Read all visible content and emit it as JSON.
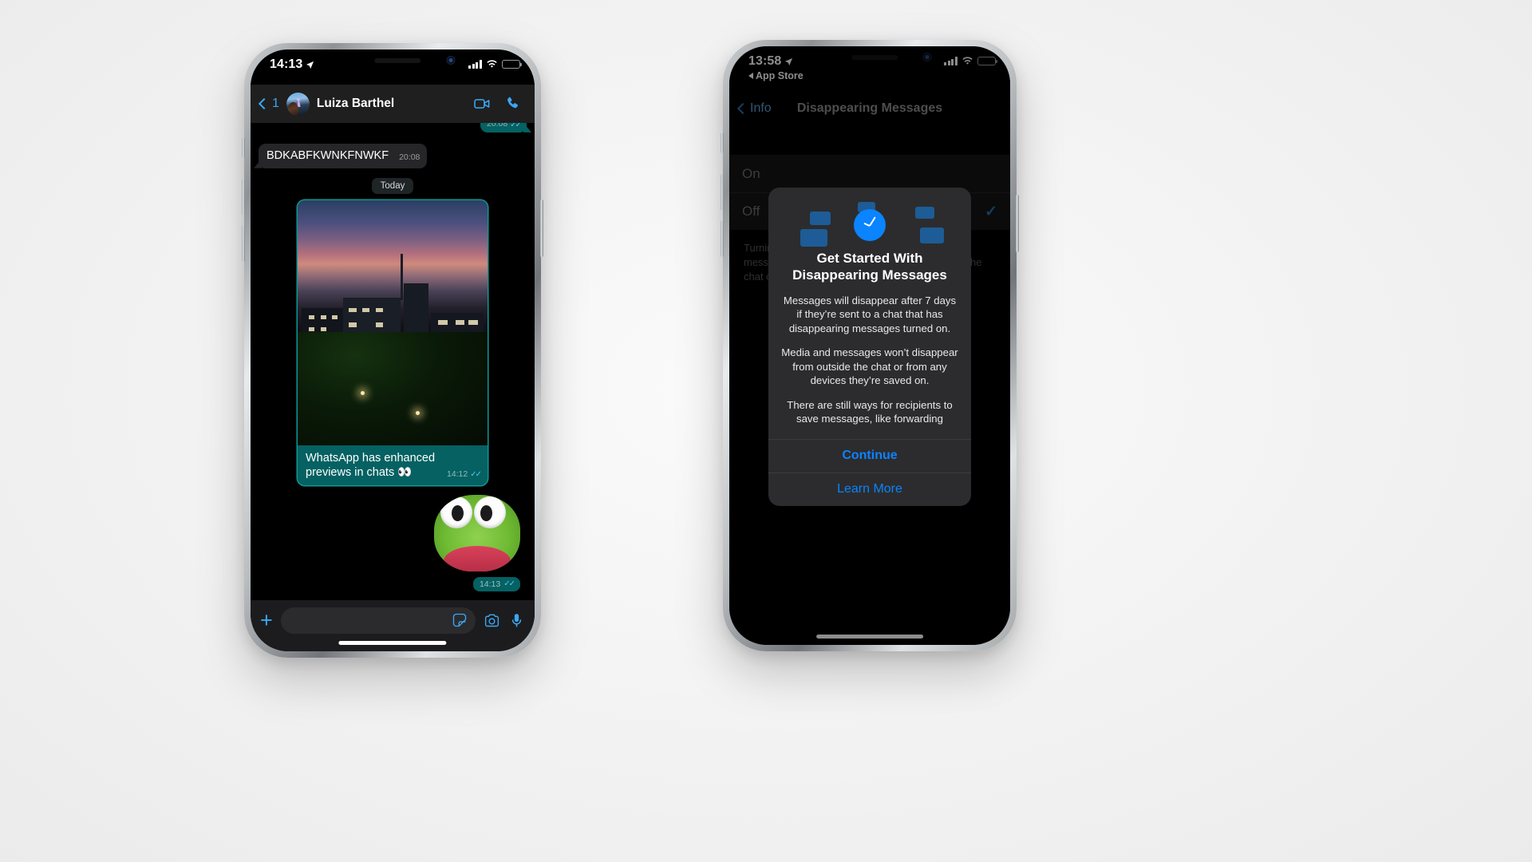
{
  "phone1": {
    "status": {
      "time": "14:13",
      "location_icon": "location-arrow-icon",
      "battery_icon": "battery-icon",
      "wifi_icon": "wifi-icon",
      "signal_icon": "cellular-bars-icon"
    },
    "header": {
      "back_icon": "chevron-left-icon",
      "unread_count": "1",
      "avatar": "contact-avatar",
      "contact_name": "Luiza Barthel",
      "video_call_icon": "video-camera-icon",
      "voice_call_icon": "phone-icon"
    },
    "messages": [
      {
        "type": "outgoing-partial",
        "text": "",
        "time": "20:08",
        "status_icon": "double-check-icon"
      },
      {
        "type": "incoming",
        "text": "BDKABFKWNKFNWKF",
        "time": "20:08"
      }
    ],
    "day_separator": "Today",
    "media_message": {
      "forward_icon": "forward-arrow-icon",
      "photo_alt": "evening-city-skyline-photo",
      "caption": "WhatsApp has enhanced previews in chats 👀",
      "time": "14:12",
      "status_icon": "double-check-icon"
    },
    "sticker_message": {
      "sticker_alt": "frog-puppet-sticker",
      "time": "14:13",
      "status_icon": "double-check-icon"
    },
    "input_bar": {
      "attach_icon": "plus-icon",
      "placeholder": "",
      "sticker_icon": "sticker-icon",
      "camera_icon": "camera-icon",
      "mic_icon": "microphone-icon"
    }
  },
  "phone2": {
    "status": {
      "time": "13:58",
      "location_icon": "location-arrow-icon",
      "back_app_label": "App Store",
      "back_app_icon": "back-triangle-icon",
      "battery_icon": "battery-icon",
      "wifi_icon": "wifi-icon",
      "signal_icon": "cellular-bars-icon"
    },
    "nav": {
      "back_icon": "chevron-left-icon",
      "back_label": "Info",
      "title": "Disappearing Messages"
    },
    "options": [
      {
        "label": "On",
        "selected": false
      },
      {
        "label": "Off",
        "selected": true,
        "check_icon": "checkmark-icon"
      }
    ],
    "footer_note": "Turning on disappearing messages will remove messages from this chat after 7 days. Anyone in the chat can change these settings.",
    "modal": {
      "hero_icon": "clock-speech-bubbles-icon",
      "title": "Get Started With Disappearing Messages",
      "paragraphs": [
        "Messages will disappear after 7 days if they’re sent to a chat that has disappearing messages turned on.",
        "Media and messages won’t disappear from outside the chat or from any devices they’re saved on.",
        "There are still ways for recipients to save messages, like forwarding"
      ],
      "primary_action": "Continue",
      "secondary_action": "Learn More"
    }
  },
  "colors": {
    "accent_blue": "#0a84ff",
    "whatsapp_teal": "#056162",
    "bubble_gray": "#262628",
    "link_blue": "#3ba7f5"
  }
}
